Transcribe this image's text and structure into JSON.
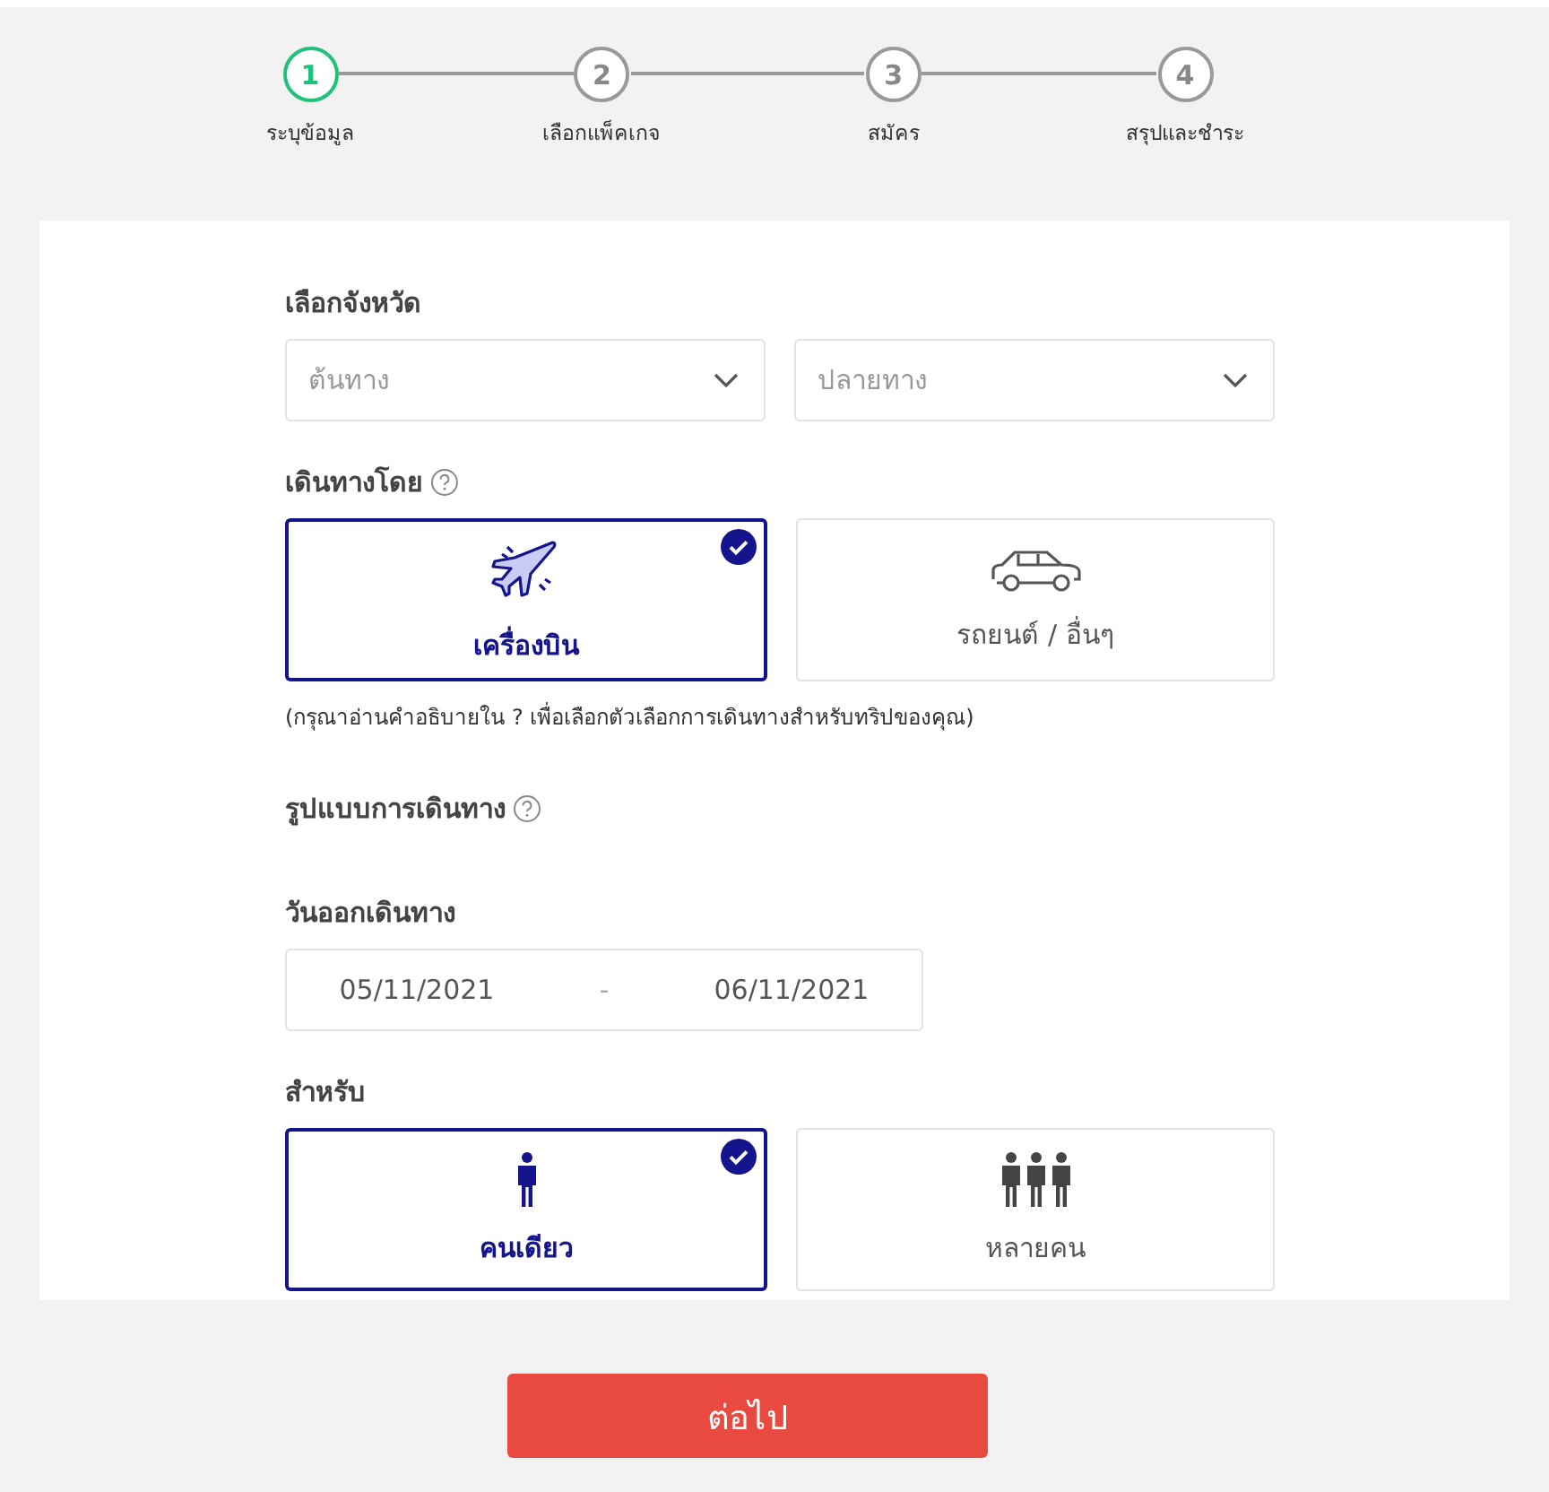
{
  "steps": [
    {
      "number": "1",
      "label": "ระบุข้อมูล",
      "selected": true
    },
    {
      "number": "2",
      "label": "เลือกแพ็คเกจ",
      "selected": false
    },
    {
      "number": "3",
      "label": "สมัคร",
      "selected": false
    },
    {
      "number": "4",
      "label": "สรุปและชำระ",
      "selected": false
    }
  ],
  "province": {
    "label": "เลือกจังหวัด",
    "fields": [
      {
        "placeholder": "ต้นทาง"
      },
      {
        "placeholder": "ปลายทาง"
      }
    ]
  },
  "travel_by": {
    "label": "เดินทางโดย",
    "help": true,
    "options": [
      {
        "kind": "plane",
        "label": "เครื่องบิน",
        "selected": true
      },
      {
        "kind": "car",
        "label": "รถยนต์ / อื่นๆ",
        "selected": false
      }
    ],
    "note": "(กรุณาอ่านคำอธิบายใน ? เพื่อเลือกตัวเลือกการเดินทางสำหรับทริปของคุณ)"
  },
  "trip_type": {
    "label": "รูปแบบการเดินทาง",
    "help": true
  },
  "dates": {
    "label": "วันออกเดินทาง",
    "start": "05/11/2021",
    "separator": "-",
    "end": "06/11/2021"
  },
  "for": {
    "label": "สำหรับ",
    "options": [
      {
        "kind": "person",
        "label": "คนเดียว",
        "selected": true
      },
      {
        "kind": "people",
        "label": "หลายคน",
        "selected": false
      }
    ]
  },
  "next_button": "ต่อไป"
}
